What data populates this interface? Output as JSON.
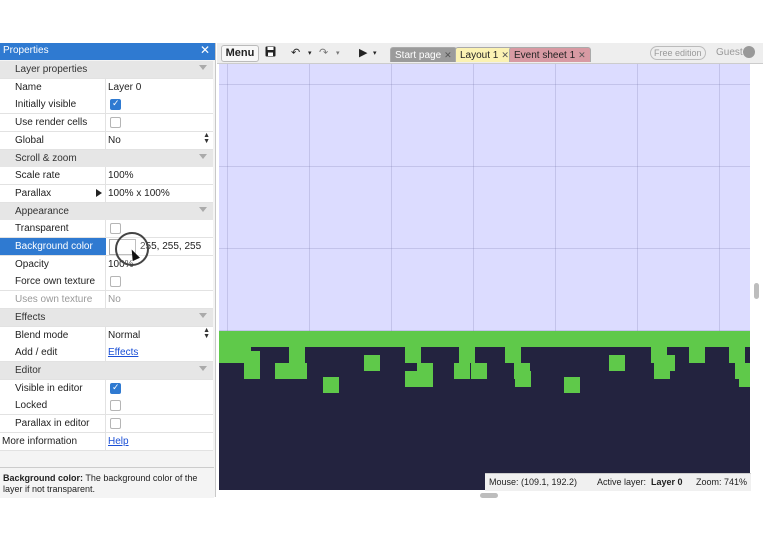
{
  "properties": {
    "title": "Properties",
    "close": "✕",
    "rows": [
      {
        "kind": "cat",
        "label": "Layer properties"
      },
      {
        "kind": "text",
        "label": "Name",
        "value": "Layer 0"
      },
      {
        "kind": "check",
        "label": "Initially visible",
        "checked": true
      },
      {
        "kind": "check",
        "label": "Use render cells",
        "checked": false
      },
      {
        "kind": "select",
        "label": "Global",
        "value": "No"
      },
      {
        "kind": "cat",
        "label": "Scroll & zoom"
      },
      {
        "kind": "text",
        "label": "Scale rate",
        "value": "100%"
      },
      {
        "kind": "expand",
        "label": "Parallax",
        "value": "100% x 100%"
      },
      {
        "kind": "cat",
        "label": "Appearance"
      },
      {
        "kind": "check",
        "label": "Transparent",
        "checked": false
      },
      {
        "kind": "color",
        "label": "Background color",
        "value": "255, 255, 255"
      },
      {
        "kind": "text",
        "label": "Opacity",
        "value": "100%"
      },
      {
        "kind": "check",
        "label": "Force own texture",
        "checked": false
      },
      {
        "kind": "disabled",
        "label": "Uses own texture",
        "value": "No"
      },
      {
        "kind": "cat",
        "label": "Effects"
      },
      {
        "kind": "select",
        "label": "Blend mode",
        "value": "Normal"
      },
      {
        "kind": "link",
        "label": "Add / edit",
        "value": "Effects"
      },
      {
        "kind": "cat",
        "label": "Editor"
      },
      {
        "kind": "check",
        "label": "Visible in editor",
        "checked": true
      },
      {
        "kind": "check",
        "label": "Locked",
        "checked": false
      },
      {
        "kind": "check",
        "label": "Parallax in editor",
        "checked": false
      },
      {
        "kind": "link0",
        "label": "More information",
        "value": "Help"
      }
    ],
    "description": {
      "bold": "Background color:",
      "text": " The background color of the layer if not transparent."
    }
  },
  "toolbar": {
    "menu": "Menu",
    "save_icon": "save-icon",
    "undo_icon": "undo-icon",
    "redo_icon": "redo-icon",
    "play_icon": "play-icon",
    "tabs": [
      {
        "label": "Start page",
        "close": "✕"
      },
      {
        "label": "Layout 1",
        "close": "✕"
      },
      {
        "label": "Event sheet 1",
        "close": "✕"
      }
    ],
    "edition": "Free edition",
    "user": "Guest"
  },
  "status": {
    "mouse": "Mouse: (109.1, 192.2)",
    "active_layer_label": "Active layer:",
    "active_layer": "Layer 0",
    "zoom": "Zoom: 741%"
  },
  "colors": {
    "accent": "#2f7ad1",
    "sky": "#dcdcff",
    "grass": "#5fc94a",
    "ground": "#23233f"
  }
}
